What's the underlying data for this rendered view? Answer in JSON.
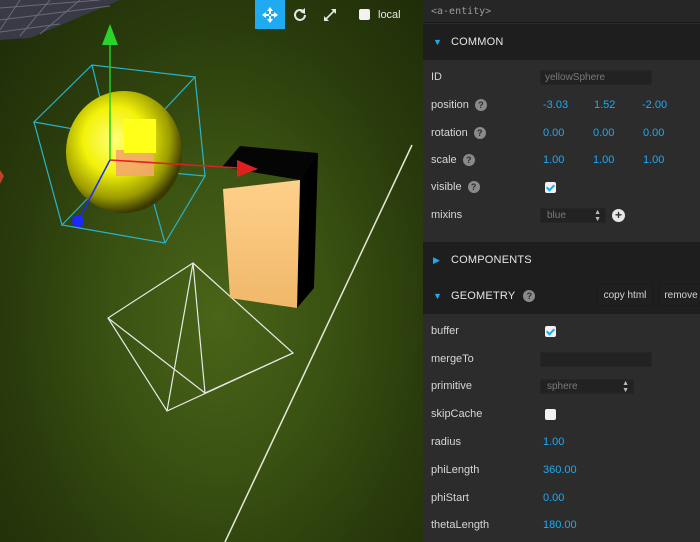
{
  "toolbar": {
    "translate_icon": "move-arrows-icon",
    "rotate_icon": "rotate-icon",
    "scale_icon": "expand-icon",
    "local_checked": false,
    "local_label": "local"
  },
  "panel": {
    "entity_tag": "<a-entity>",
    "common": {
      "title": "COMMON",
      "id_label": "ID",
      "id_value": "yellowSphere",
      "position_label": "position",
      "position": [
        "-3.03",
        "1.52",
        "-2.00"
      ],
      "rotation_label": "rotation",
      "rotation": [
        "0.00",
        "0.00",
        "0.00"
      ],
      "scale_label": "scale",
      "scale": [
        "1.00",
        "1.00",
        "1.00"
      ],
      "visible_label": "visible",
      "visible_checked": true,
      "mixins_label": "mixins",
      "mixins_value": "blue"
    },
    "components": {
      "title": "COMPONENTS"
    },
    "geometry": {
      "title": "GEOMETRY",
      "copy_html_label": "copy html",
      "remove_label": "remove",
      "buffer_label": "buffer",
      "buffer_checked": true,
      "mergeTo_label": "mergeTo",
      "mergeTo_value": "",
      "primitive_label": "primitive",
      "primitive_value": "sphere",
      "skipCache_label": "skipCache",
      "skipCache_checked": false,
      "radius_label": "radius",
      "radius_value": "1.00",
      "phiLength_label": "phiLength",
      "phiLength_value": "360.00",
      "phiStart_label": "phiStart",
      "phiStart_value": "0.00",
      "thetaLength_label": "thetaLength",
      "thetaLength_value": "180.00"
    }
  },
  "colors": {
    "accent": "#1faaf2",
    "panel_bg": "#2c2c2c",
    "section_bg": "#1e1e1e",
    "ground": "#3a5212",
    "sphere": "#f2f20a",
    "box": "#f5c27a"
  }
}
